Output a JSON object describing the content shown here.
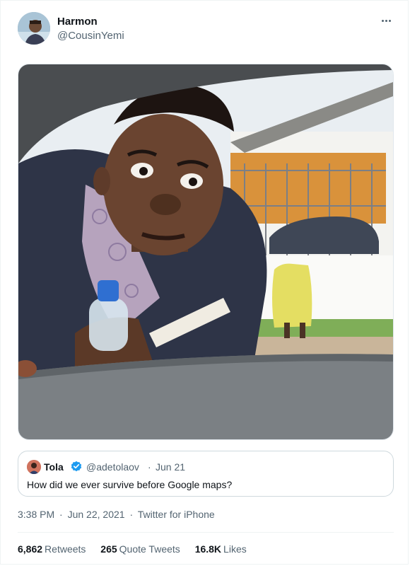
{
  "tweet": {
    "author": {
      "name": "Harmon",
      "handle": "@CousinYemi",
      "avatar_icon": "profile-photo"
    },
    "more_icon": "ellipsis-icon",
    "media": {
      "kind": "photo",
      "description_icon": "tweet-photo"
    },
    "quoted_tweet": {
      "author_name": "Tola",
      "verified": true,
      "handle": "@adetolaov",
      "separator": "·",
      "date": "Jun 21",
      "text": "How did we ever survive before Google maps?"
    },
    "meta": {
      "time": "3:38 PM",
      "separator": "·",
      "date": "Jun 22, 2021",
      "source": "Twitter for iPhone"
    },
    "stats": [
      {
        "count": "6,862",
        "label": "Retweets"
      },
      {
        "count": "265",
        "label": "Quote Tweets"
      },
      {
        "count": "16.8K",
        "label": "Likes"
      }
    ]
  },
  "colors": {
    "text_primary": "#0f1419",
    "text_secondary": "#536471",
    "verified_blue": "#1d9bf0",
    "border": "#cfd9de"
  }
}
